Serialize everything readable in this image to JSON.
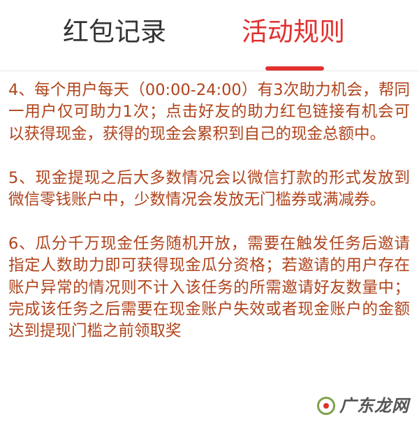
{
  "tabs": {
    "records": "红包记录",
    "rules": "活动规则"
  },
  "rules": [
    "4、每个用户每天（00:00-24:00）有3次助力机会，帮同一用户仅可助力1次；点击好友的助力红包链接有机会可以获得现金，获得的现金会累积到自己的现金总额中。",
    "5、现金提现之后大多数情况会以微信打款的形式发放到微信零钱账户中，少数情况会发放无门槛券或满减券。",
    "6、瓜分千万现金任务随机开放，需要在触发任务后邀请指定人数助力即可获得现金瓜分资格；若邀请的用户存在账户异常的情况则不计入该任务的所需邀请好友数量中；完成该任务之后需要在现金账户失效或者现金账户的金额达到提现门槛之前领取奖"
  ],
  "watermark": {
    "text": "广东龙网",
    "icon": "globe-logo-icon"
  },
  "colors": {
    "accent": "#e0312f",
    "rule_text": "#b0431b",
    "inactive_tab": "#333333"
  }
}
